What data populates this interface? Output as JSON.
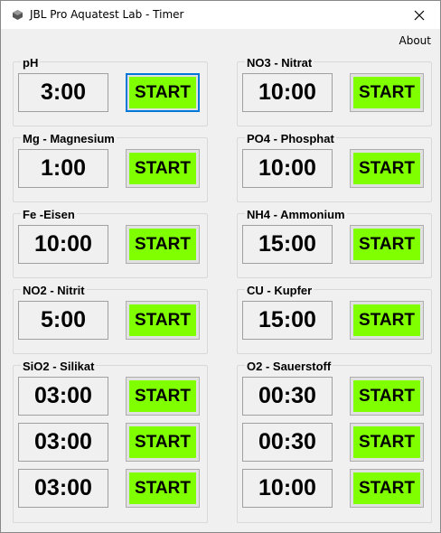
{
  "window": {
    "title": "JBL Pro Aquatest Lab - Timer",
    "close_glyph": "✕"
  },
  "menu": {
    "about": "About"
  },
  "colors": {
    "start_face": "#80ff00",
    "focus_border": "#0078d7"
  },
  "start_label": "START",
  "groups": {
    "ph": {
      "title": "pH",
      "timers": [
        "3:00"
      ]
    },
    "no3": {
      "title": "NO3 - Nitrat",
      "timers": [
        "10:00"
      ]
    },
    "mg": {
      "title": "Mg - Magnesium",
      "timers": [
        "1:00"
      ]
    },
    "po4": {
      "title": "PO4 - Phosphat",
      "timers": [
        "10:00"
      ]
    },
    "fe": {
      "title": "Fe -Eisen",
      "timers": [
        "10:00"
      ]
    },
    "nh4": {
      "title": "NH4 - Ammonium",
      "timers": [
        "15:00"
      ]
    },
    "no2": {
      "title": "NO2 - Nitrit",
      "timers": [
        "5:00"
      ]
    },
    "cu": {
      "title": "CU - Kupfer",
      "timers": [
        "15:00"
      ]
    },
    "sio2": {
      "title": "SiO2 - Silikat",
      "timers": [
        "03:00",
        "03:00",
        "03:00"
      ]
    },
    "o2": {
      "title": "O2 - Sauerstoff",
      "timers": [
        "00:30",
        "00:30",
        "10:00"
      ]
    }
  }
}
